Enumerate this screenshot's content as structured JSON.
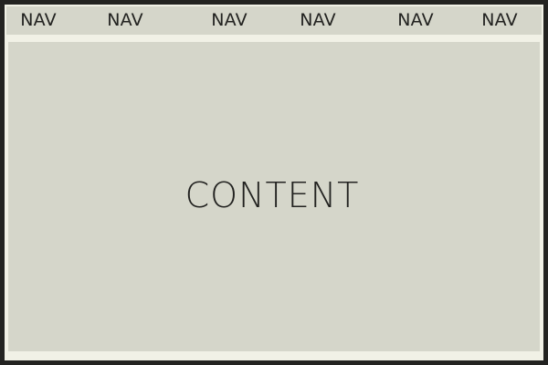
{
  "nav": {
    "items": [
      {
        "label": "NAV"
      },
      {
        "label": "NAV"
      },
      {
        "label": "NAV"
      },
      {
        "label": "NAV"
      },
      {
        "label": "NAV"
      },
      {
        "label": "NAV"
      }
    ]
  },
  "main": {
    "label": "CONTENT"
  },
  "colors": {
    "outer_border": "#232321",
    "frame": "#f1f1e6",
    "panel": "#d5d6ca",
    "text": "#222220"
  }
}
